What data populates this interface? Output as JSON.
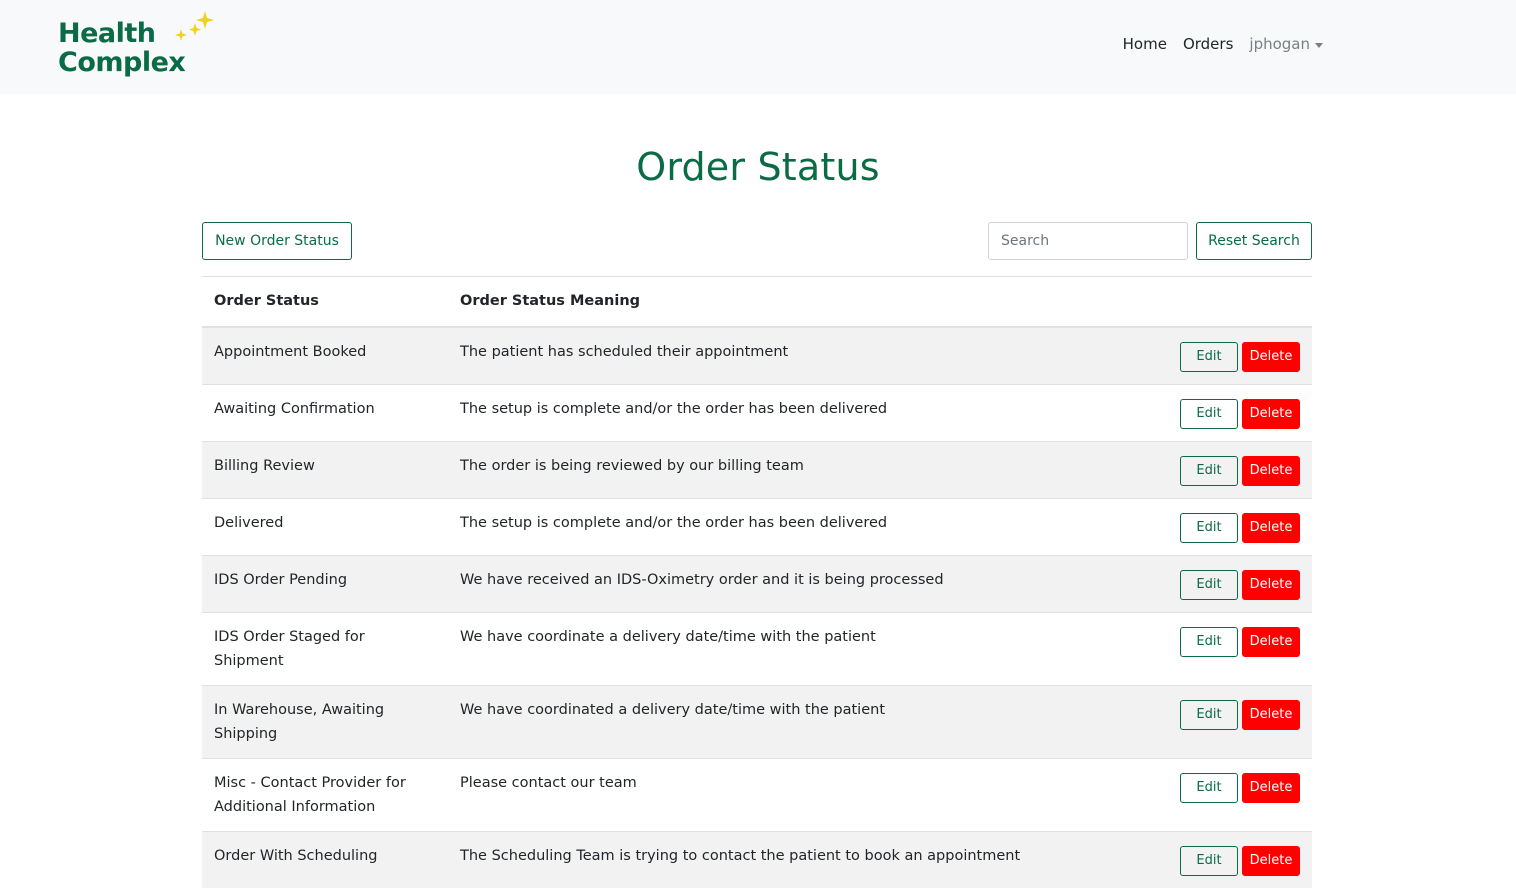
{
  "brand": {
    "line1": "Health",
    "line2": "Complex",
    "primary_color": "#0b6b45",
    "sparkle_color": "#f2d11b"
  },
  "nav": {
    "home": "Home",
    "orders": "Orders",
    "user": "jphogan"
  },
  "page": {
    "title": "Order Status"
  },
  "toolbar": {
    "new_label": "New Order Status",
    "search_placeholder": "Search",
    "reset_label": "Reset Search"
  },
  "table": {
    "headers": {
      "status": "Order Status",
      "meaning": "Order Status Meaning"
    },
    "edit_label": "Edit",
    "delete_label": "Delete",
    "delete_color": "#ff0000",
    "rows": [
      {
        "status": "Appointment Booked",
        "meaning": "The patient has scheduled their appointment"
      },
      {
        "status": "Awaiting Confirmation",
        "meaning": "The setup is complete and/or the order has been delivered"
      },
      {
        "status": "Billing Review",
        "meaning": "The order is being reviewed by our billing team"
      },
      {
        "status": "Delivered",
        "meaning": "The setup is complete and/or the order has been delivered"
      },
      {
        "status": "IDS Order Pending",
        "meaning": "We have received an IDS-Oximetry order and it is being processed"
      },
      {
        "status": "IDS Order Staged for Shipment",
        "meaning": "We have coordinate a delivery date/time with the patient"
      },
      {
        "status": "In Warehouse, Awaiting Shipping",
        "meaning": "We have coordinated a delivery date/time with the patient"
      },
      {
        "status": "Misc - Contact Provider for Additional Information",
        "meaning": "Please contact our team"
      },
      {
        "status": "Order With Scheduling",
        "meaning": "The Scheduling Team is trying to contact the patient to book an appointment"
      }
    ]
  }
}
